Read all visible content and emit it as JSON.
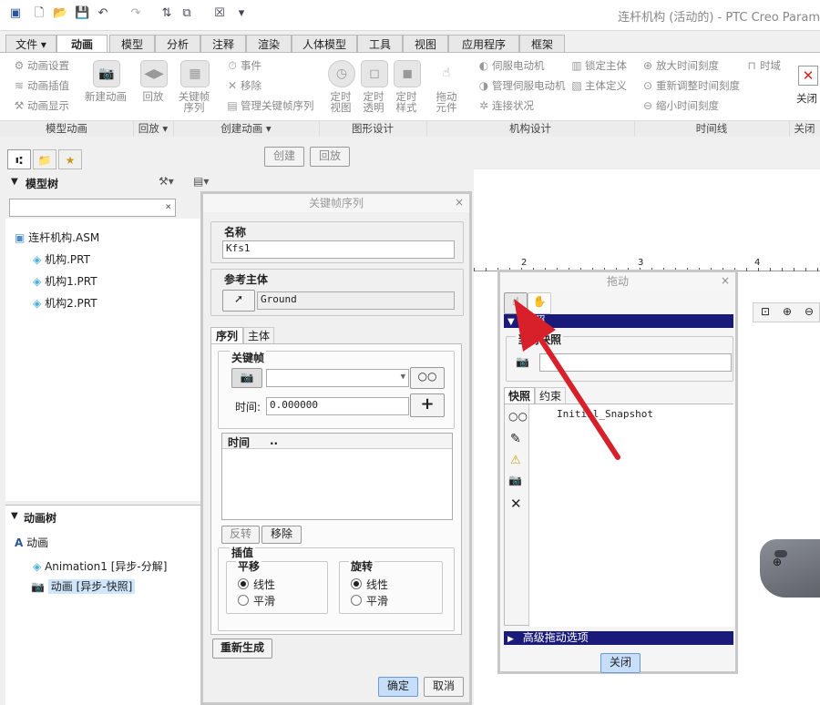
{
  "window": {
    "title": "连杆机构 (活动的) - PTC Creo Param"
  },
  "tabs": [
    {
      "label": "文件 ▾"
    },
    {
      "label": "动画"
    },
    {
      "label": "模型"
    },
    {
      "label": "分析"
    },
    {
      "label": "注释"
    },
    {
      "label": "渲染"
    },
    {
      "label": "人体模型"
    },
    {
      "label": "工具"
    },
    {
      "label": "视图"
    },
    {
      "label": "应用程序"
    },
    {
      "label": "框架"
    }
  ],
  "ribbon": {
    "model_anim": [
      "动画设置",
      "动画插值",
      "动画显示"
    ],
    "new_anim": "新建动画",
    "playback": "回放",
    "keyframe_seq": [
      "关键帧",
      "序列"
    ],
    "create_items": [
      "事件",
      "移除",
      "管理关键帧序列"
    ],
    "graphic_btns": [
      [
        "定时",
        "视图"
      ],
      [
        "定时",
        "透明"
      ],
      [
        "定时",
        "样式"
      ]
    ],
    "drag_btn": [
      "拖动",
      "元件"
    ],
    "mech_items": [
      "伺服电动机",
      "管理伺服电动机",
      "连接状况"
    ],
    "mech_items2": [
      "锁定主体",
      "主体定义"
    ],
    "timeline_items": [
      "放大时间刻度",
      "重新调整时间刻度",
      "缩小时间刻度"
    ],
    "timeline_extra": "时域",
    "close": "关闭",
    "groups": [
      "模型动画",
      "回放 ▾",
      "创建动画 ▾",
      "图形设计",
      "机构设计",
      "时间线",
      "关闭"
    ]
  },
  "toolbar2": {
    "create": "创建",
    "playback": "回放"
  },
  "model_tree": {
    "title": "模型树",
    "items": [
      {
        "label": "连杆机构.ASM"
      },
      {
        "label": "机构.PRT"
      },
      {
        "label": "机构1.PRT"
      },
      {
        "label": "机构2.PRT"
      }
    ]
  },
  "anim_tree": {
    "title": "动画树",
    "items": [
      {
        "label": "动画"
      },
      {
        "label": "Animation1 [异步-分解]"
      },
      {
        "label": "动画 [异步-快照]"
      }
    ]
  },
  "keyframe_dialog": {
    "title": "关键帧序列",
    "name_label": "名称",
    "name_value": "Kfs1",
    "ref_body_label": "参考主体",
    "ref_body_value": "Ground",
    "tabs": [
      "序列",
      "主体"
    ],
    "keyframe_label": "关键帧",
    "time_label": "时间:",
    "time_value": "0.000000",
    "table_headers": [
      "时间",
      ".."
    ],
    "reverse": "反转",
    "remove": "移除",
    "interp_label": "插值",
    "translate_label": "平移",
    "rotate_label": "旋转",
    "linear": "线性",
    "smooth": "平滑",
    "regen": "重新生成",
    "ok": "确定",
    "cancel": "取消"
  },
  "drag_dialog": {
    "title": "拖动",
    "snapshot_bar": "快照",
    "current_snapshot": "当前快照",
    "tabs": [
      "快照",
      "约束"
    ],
    "snapshot_item": "Initial_Snapshot",
    "advanced": "高级拖动选项",
    "close": "关闭"
  },
  "ruler": {
    "labels": [
      "2",
      "3",
      "4"
    ]
  },
  "colors": {
    "accent": "#1a1a7a",
    "arrow": "#d8202a",
    "selection": "#cfe6fb"
  }
}
